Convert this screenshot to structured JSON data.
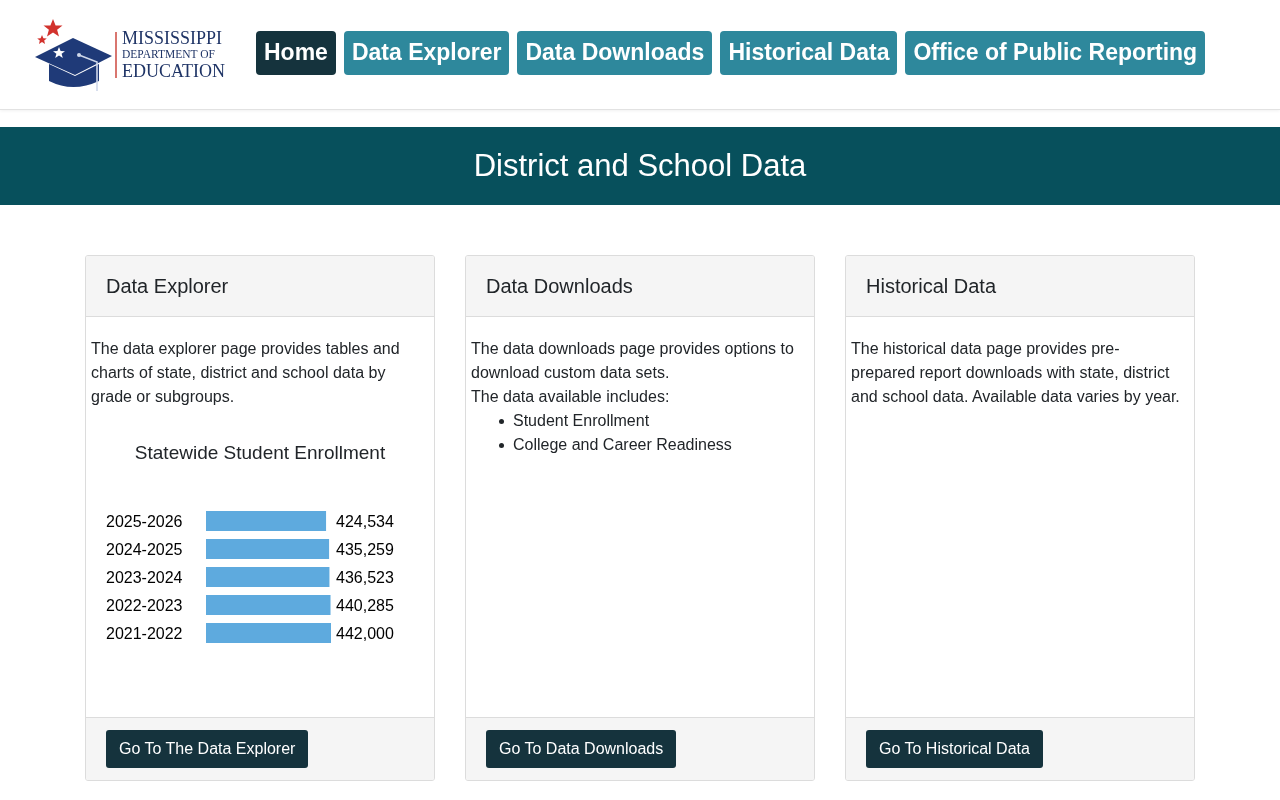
{
  "header": {
    "logo": {
      "lines": [
        "MISSISSIPPI",
        "DEPARTMENT OF",
        "EDUCATION"
      ]
    },
    "nav": [
      {
        "label": "Home",
        "selected": true
      },
      {
        "label": "Data Explorer",
        "selected": false
      },
      {
        "label": "Data Downloads",
        "selected": false
      },
      {
        "label": "Historical Data",
        "selected": false
      },
      {
        "label": "Office of Public Reporting",
        "selected": false
      }
    ]
  },
  "banner": {
    "title": "District and School Data"
  },
  "cards": [
    {
      "title": "Data Explorer",
      "body": [
        "The data explorer page provides tables and charts of state, district and school data by grade or subgroups."
      ],
      "chart_data": {
        "type": "bar",
        "orientation": "horizontal",
        "title": "Statewide Student Enrollment",
        "categories": [
          "2025-2026",
          "2024-2025",
          "2023-2024",
          "2022-2023",
          "2021-2022"
        ],
        "values": [
          424534,
          435259,
          436523,
          440285,
          442000
        ],
        "xlim": [
          0,
          442000
        ],
        "value_labels": [
          "424,534",
          "435,259",
          "436,523",
          "440,285",
          "442,000"
        ]
      },
      "button": "Go To The Data Explorer"
    },
    {
      "title": "Data Downloads",
      "body": [
        "The data downloads page provides options to download custom data sets.",
        "The data available includes:"
      ],
      "list": [
        "Student Enrollment",
        "College and Career Readiness"
      ],
      "button": "Go To Data Downloads"
    },
    {
      "title": "Historical Data",
      "body": [
        "The historical data page provides pre-prepared report downloads with state, district and school data. Available data varies by year."
      ],
      "button": "Go To Historical Data"
    }
  ]
}
